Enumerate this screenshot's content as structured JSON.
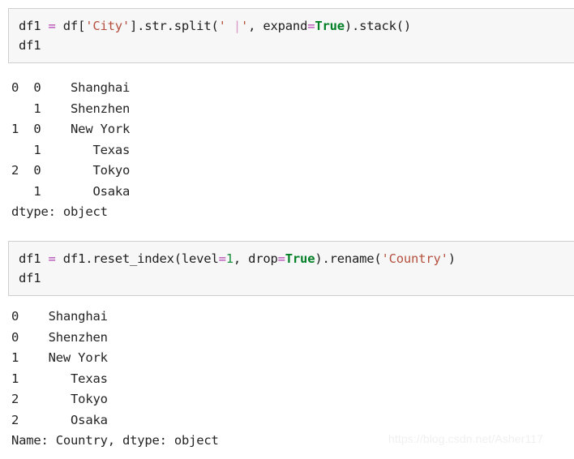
{
  "cells": [
    {
      "id": "cell-1",
      "code_lines": [
        {
          "tokens": [
            {
              "text": "df1 ",
              "type": "plain"
            },
            {
              "text": "=",
              "type": "op"
            },
            {
              "text": " df[",
              "type": "plain"
            },
            {
              "text": "'City'",
              "type": "str"
            },
            {
              "text": "].str.split(",
              "type": "plain"
            },
            {
              "text": "' ",
              "type": "str"
            },
            {
              "text": "|",
              "type": "sep"
            },
            {
              "text": "'",
              "type": "str"
            },
            {
              "text": ", expand",
              "type": "plain"
            },
            {
              "text": "=",
              "type": "op"
            },
            {
              "text": "True",
              "type": "bool"
            },
            {
              "text": ").stack()",
              "type": "plain"
            }
          ]
        },
        {
          "tokens": [
            {
              "text": "df1",
              "type": "plain"
            }
          ]
        }
      ],
      "output_lines": [
        "0  0    Shanghai",
        "   1    Shenzhen",
        "1  0    New York",
        "   1       Texas",
        "2  0       Tokyo",
        "   1       Osaka",
        "dtype: object"
      ]
    },
    {
      "id": "cell-2",
      "code_lines": [
        {
          "tokens": [
            {
              "text": "df1 ",
              "type": "plain"
            },
            {
              "text": "=",
              "type": "op"
            },
            {
              "text": " df1.reset_index(level",
              "type": "plain"
            },
            {
              "text": "=",
              "type": "op"
            },
            {
              "text": "1",
              "type": "num"
            },
            {
              "text": ", drop",
              "type": "plain"
            },
            {
              "text": "=",
              "type": "op"
            },
            {
              "text": "True",
              "type": "bool"
            },
            {
              "text": ").rename(",
              "type": "plain"
            },
            {
              "text": "'Country'",
              "type": "str"
            },
            {
              "text": ")",
              "type": "plain"
            }
          ]
        },
        {
          "tokens": [
            {
              "text": "df1",
              "type": "plain"
            }
          ]
        }
      ],
      "output_lines": [
        "0    Shanghai",
        "0    Shenzhen",
        "1    New York",
        "1       Texas",
        "2       Tokyo",
        "2       Osaka",
        "Name: Country, dtype: object"
      ]
    }
  ],
  "watermark": {
    "text": "https://blog.csdn.net/Asher117"
  },
  "colors": {
    "cell_background": "#f7f7f7",
    "cell_border": "#cfcfcf",
    "string_token": "#b5503f",
    "boolean_token": "#007f26",
    "operator_token": "#b040b0",
    "number_token": "#1a8f3c",
    "separator_token": "#d99ac8",
    "text": "#242424",
    "watermark": "#f0f0f0"
  }
}
